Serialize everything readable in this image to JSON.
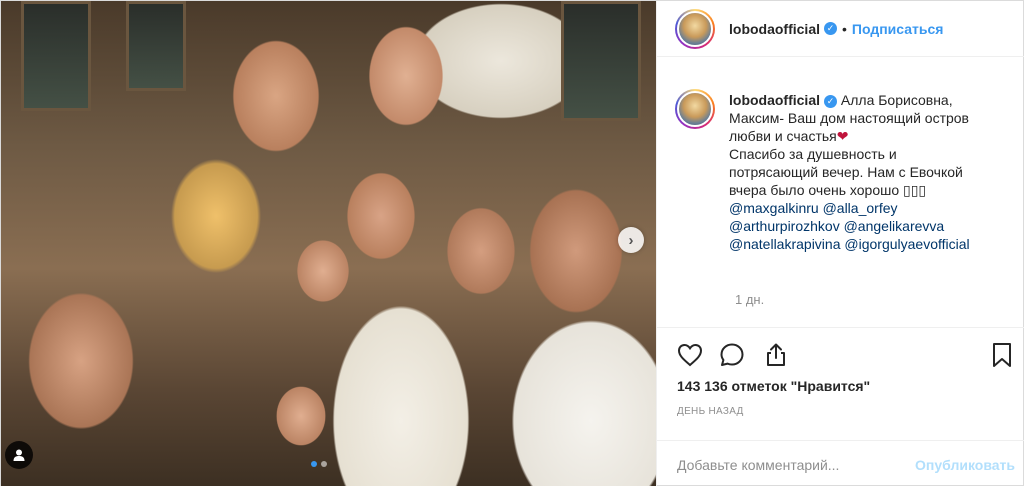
{
  "post": {
    "photo": {
      "alt_icon": "user-tag-icon",
      "next_icon": "chevron-right-icon",
      "carousel": {
        "count": 2,
        "active": 1
      }
    },
    "header": {
      "username": "lobodaofficial",
      "verified_icon": "verified-check-icon",
      "separator": "•",
      "follow_label": "Подписаться"
    },
    "caption": {
      "username": "lobodaofficial",
      "text_lines": [
        "Алла Борисовна,",
        "Максим- Ваш дом настоящий остров",
        "любви и счастья",
        "Спасибо за душевность и",
        "потрясающий вечер. Нам с Евочкой",
        "вчера было очень хорошо ▯▯▯"
      ],
      "heart": "❤",
      "mentions": [
        "@maxgalkinru",
        "@alla_orfey",
        "@arthurpirozhkov",
        "@angelikarevva",
        "@natellakrapivina",
        "@igorgulyaevofficial"
      ],
      "time": "1 дн."
    },
    "actions": {
      "like_icon": "heart-icon",
      "comment_icon": "comment-icon",
      "share_icon": "share-icon",
      "save_icon": "bookmark-icon",
      "likes_text": "143 136 отметок \"Нравится\"",
      "date_text": "ДЕНЬ НАЗАД"
    },
    "comment": {
      "placeholder": "Добавьте комментарий...",
      "publish_label": "Опубликовать"
    },
    "colors": {
      "accent": "#3897f0",
      "publish_disabled": "#b2dffc",
      "heart": "#c0143c",
      "muted": "#8e8e8e"
    }
  }
}
